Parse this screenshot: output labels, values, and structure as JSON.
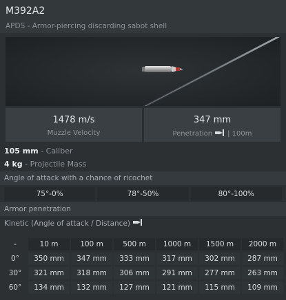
{
  "shell": {
    "name": "M392A2",
    "type": "APDS - Armor-piercing discarding sabot shell"
  },
  "stats": {
    "muzzle_velocity": {
      "value": "1478 m/s",
      "label": "Muzzle Velocity"
    },
    "penetration": {
      "value": "347 mm",
      "label": "Penetration",
      "suffix": "| 100m",
      "icon": "shell-penetration-icon"
    }
  },
  "specs": [
    {
      "value": "105 mm",
      "label": " - Caliber"
    },
    {
      "value": "4 kg",
      "label": " - Projectile Mass"
    }
  ],
  "ricochet": {
    "heading": "Angle of attack with a chance of ricochet",
    "cells": [
      "75°-0%",
      "78°-50%",
      "80°-100%"
    ]
  },
  "armor": {
    "heading": "Armor penetration",
    "kinetic_label": "Kinetic (Angle of attack / Distance)",
    "icon": "shell-penetration-icon",
    "corner": "-",
    "columns": [
      "10 m",
      "100 m",
      "500 m",
      "1000 m",
      "1500 m",
      "2000 m"
    ],
    "rows": [
      {
        "angle": "0°",
        "values": [
          "350 mm",
          "347 mm",
          "333 mm",
          "317 mm",
          "302 mm",
          "287 mm"
        ]
      },
      {
        "angle": "30°",
        "values": [
          "321 mm",
          "318 mm",
          "306 mm",
          "291 mm",
          "277 mm",
          "263 mm"
        ]
      },
      {
        "angle": "60°",
        "values": [
          "134 mm",
          "132 mm",
          "127 mm",
          "121 mm",
          "115 mm",
          "109 mm"
        ]
      }
    ]
  },
  "colors": {
    "background": "#2c3033",
    "header": "#33383b",
    "stat_box": "#3a3f43",
    "section_bar": "#353a3e",
    "cell_dark": "#262a2d"
  }
}
